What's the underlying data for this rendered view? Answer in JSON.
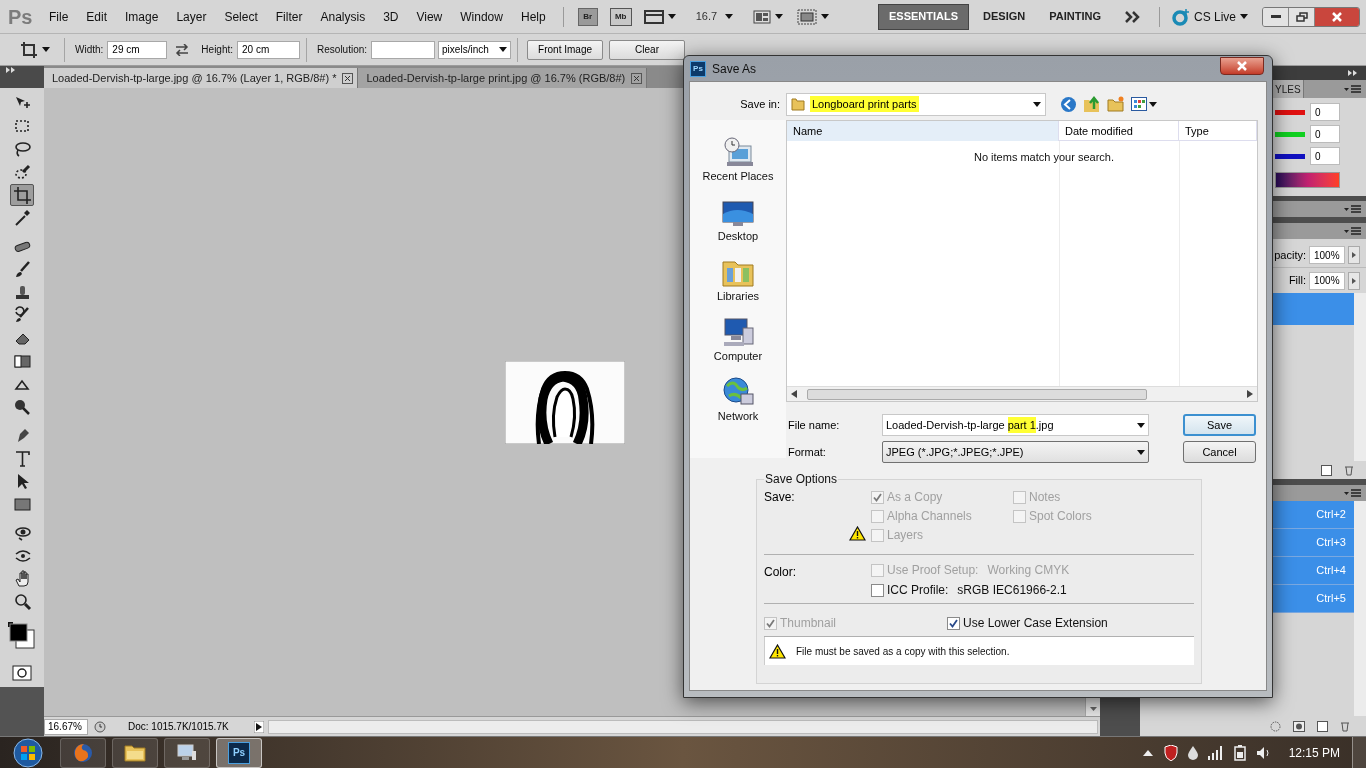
{
  "app": {
    "logo": "Ps",
    "menu": [
      "File",
      "Edit",
      "Image",
      "Layer",
      "Select",
      "Filter",
      "Analysis",
      "3D",
      "View",
      "Window",
      "Help"
    ],
    "bridge": "Br",
    "mini_bridge": "Mb",
    "zoom": "16.7",
    "workspaces": [
      {
        "label": "ESSENTIALS",
        "selected": true
      },
      {
        "label": "DESIGN",
        "selected": false
      },
      {
        "label": "PAINTING",
        "selected": false
      }
    ],
    "cs_live": "CS Live"
  },
  "options_bar": {
    "width_label": "Width:",
    "width": "29 cm",
    "height_label": "Height:",
    "height": "20 cm",
    "resolution_label": "Resolution:",
    "resolution_unit": "pixels/inch",
    "buttons": [
      "Front Image",
      "Clear"
    ]
  },
  "document_tabs": [
    {
      "label": "Loaded-Dervish-tp-large.jpg @ 16.7% (Layer 1, RGB/8#) *",
      "selected": true
    },
    {
      "label": "Loaded-Dervish-tp-large print.jpg @ 16.7% (RGB/8#)",
      "selected": false
    }
  ],
  "tools": [
    {
      "kind": "move",
      "selected": false
    },
    {
      "kind": "marquee",
      "selected": false
    },
    {
      "kind": "lasso",
      "selected": false
    },
    {
      "kind": "quickselect",
      "selected": false
    },
    {
      "kind": "crop",
      "selected": true
    },
    {
      "kind": "eyedropper",
      "selected": false
    },
    {
      "kind": "healing",
      "selected": false
    },
    {
      "kind": "brush",
      "selected": false
    },
    {
      "kind": "stamp",
      "selected": false
    },
    {
      "kind": "historybrush",
      "selected": false
    },
    {
      "kind": "eraser",
      "selected": false
    },
    {
      "kind": "gradient",
      "selected": false
    },
    {
      "kind": "blur",
      "selected": false
    },
    {
      "kind": "dodge",
      "selected": false
    },
    {
      "kind": "pen",
      "selected": false
    },
    {
      "kind": "type",
      "selected": false
    },
    {
      "kind": "pathselect",
      "selected": false
    },
    {
      "kind": "rectangle",
      "selected": false
    },
    {
      "kind": "rotate3d",
      "selected": false
    },
    {
      "kind": "orbit3d",
      "selected": false
    },
    {
      "kind": "hand",
      "selected": false
    },
    {
      "kind": "zoom",
      "selected": false
    }
  ],
  "panels": {
    "styles_tab": "YLES",
    "rgb": [
      {
        "value": "0",
        "color": "#e01010"
      },
      {
        "value": "0",
        "color": "#10d020"
      },
      {
        "value": "0",
        "color": "#1010c0"
      }
    ],
    "opacity_label": "pacity:",
    "opacity": "100%",
    "fill_label": "Fill:",
    "fill": "100%",
    "channels": [
      {
        "shortcut": "Ctrl+2",
        "selected": true
      },
      {
        "shortcut": "Ctrl+3",
        "selected": true
      },
      {
        "shortcut": "Ctrl+4",
        "selected": true
      },
      {
        "shortcut": "Ctrl+5",
        "selected": true
      }
    ]
  },
  "status_bar": {
    "zoom": "16.67%",
    "doc": "Doc: 1015.7K/1015.7K"
  },
  "dialog": {
    "icon": "Ps",
    "title": "Save As",
    "save_in": {
      "label": "Save in:",
      "value": "Longboard print parts",
      "highlighted": true
    },
    "places": [
      {
        "kind": "recent",
        "label": "Recent Places"
      },
      {
        "kind": "desktop",
        "label": "Desktop"
      },
      {
        "kind": "libraries",
        "label": "Libraries"
      },
      {
        "kind": "computer",
        "label": "Computer"
      },
      {
        "kind": "network",
        "label": "Network"
      }
    ],
    "file_list": {
      "columns": [
        "Name",
        "Date modified",
        "Type"
      ],
      "empty_message": "No items match your search."
    },
    "file_name": {
      "label": "File name:",
      "value_parts": [
        {
          "text": "Loaded-Dervish-tp-large ",
          "highlighted": false
        },
        {
          "text": "part 1",
          "highlighted": true
        },
        {
          "text": ".jpg",
          "highlighted": false
        }
      ]
    },
    "format": {
      "label": "Format:",
      "value": "JPEG (*.JPG;*.JPEG;*.JPE)"
    },
    "buttons": [
      {
        "label": "Save",
        "default": true
      },
      {
        "label": "Cancel",
        "default": false
      }
    ],
    "save_options": {
      "title": "Save Options",
      "save_label": "Save:",
      "save_checks": [
        {
          "label": "As a Copy",
          "checked": true,
          "disabled": true,
          "warning": false
        },
        {
          "label": "Notes",
          "checked": false,
          "disabled": true,
          "warning": false
        },
        {
          "label": "Alpha Channels",
          "checked": false,
          "disabled": true,
          "warning": false
        },
        {
          "label": "Spot Colors",
          "checked": false,
          "disabled": true,
          "warning": false
        },
        {
          "label": "Layers",
          "checked": false,
          "disabled": true,
          "warning": true
        }
      ],
      "color_label": "Color:",
      "color_checks": [
        {
          "label": "Use Proof Setup:",
          "value": "Working CMYK",
          "checked": false,
          "disabled": true
        },
        {
          "label": "ICC Profile:",
          "value": "sRGB IEC61966-2.1",
          "checked": false,
          "disabled": false
        }
      ],
      "bottom_checks": [
        {
          "label": "Thumbnail",
          "checked": true,
          "disabled": true
        },
        {
          "label": "Use Lower Case Extension",
          "checked": true,
          "disabled": false
        }
      ],
      "message": "File must be saved as a copy with this selection."
    }
  },
  "taskbar": {
    "apps": [
      {
        "kind": "firefox",
        "selected": false
      },
      {
        "kind": "explorer",
        "selected": false
      },
      {
        "kind": "devices",
        "selected": false
      },
      {
        "kind": "photoshop",
        "label": "Ps",
        "selected": true
      }
    ],
    "clock": "12:15 PM"
  }
}
